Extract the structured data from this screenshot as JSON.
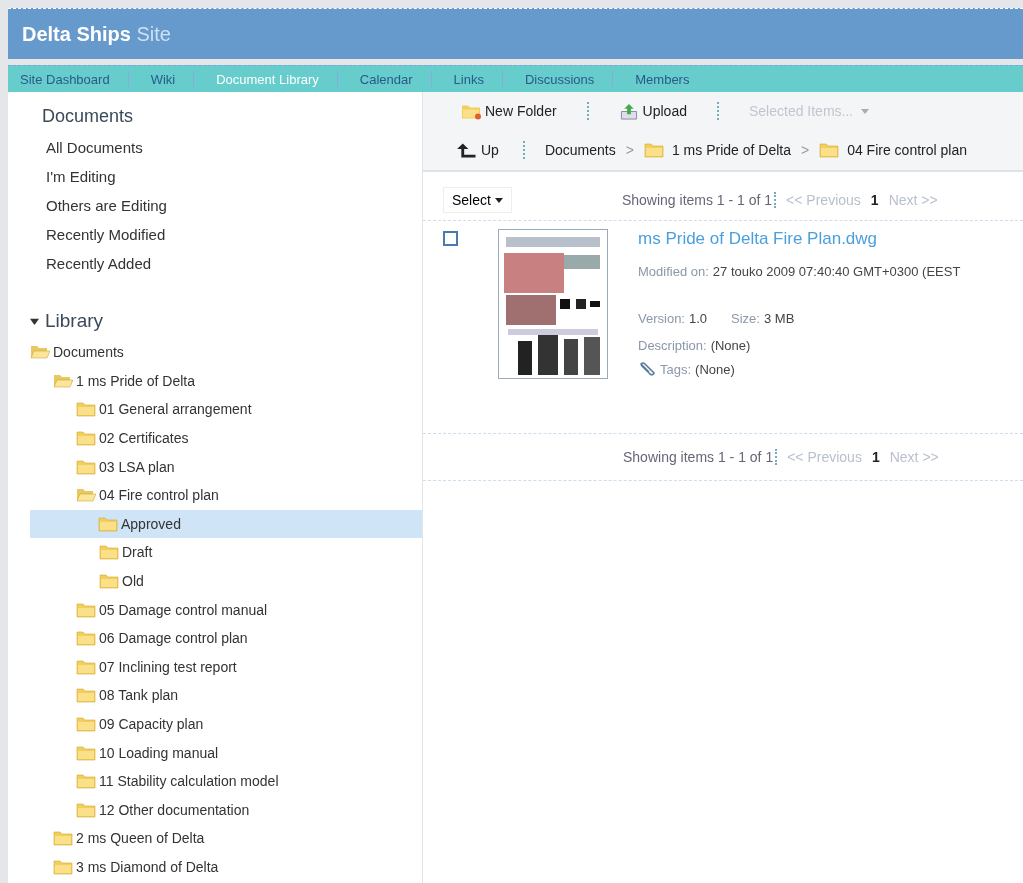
{
  "header": {
    "title": "Delta Ships",
    "subtitle": "Site"
  },
  "nav": [
    {
      "label": "Site Dashboard",
      "selected": false
    },
    {
      "label": "Wiki",
      "selected": false
    },
    {
      "label": "Document Library",
      "selected": true
    },
    {
      "label": "Calendar",
      "selected": false
    },
    {
      "label": "Links",
      "selected": false
    },
    {
      "label": "Discussions",
      "selected": false
    },
    {
      "label": "Members",
      "selected": false
    }
  ],
  "sidebar": {
    "filters_title": "Documents",
    "filters": [
      "All Documents",
      "I'm Editing",
      "Others are Editing",
      "Recently Modified",
      "Recently Added"
    ],
    "library": {
      "title": "Library",
      "expanded": true,
      "tree": [
        {
          "label": "Documents",
          "expanded": true,
          "selected": false,
          "children": [
            {
              "label": "1 ms Pride of Delta",
              "expanded": true,
              "selected": false,
              "children": [
                {
                  "label": "01 General arrangement",
                  "expanded": false,
                  "selected": false
                },
                {
                  "label": "02 Certificates",
                  "expanded": false,
                  "selected": false
                },
                {
                  "label": "03 LSA plan",
                  "expanded": false,
                  "selected": false
                },
                {
                  "label": "04 Fire control plan",
                  "expanded": true,
                  "selected": false,
                  "children": [
                    {
                      "label": "Approved",
                      "expanded": false,
                      "selected": true
                    },
                    {
                      "label": "Draft",
                      "expanded": false,
                      "selected": false
                    },
                    {
                      "label": "Old",
                      "expanded": false,
                      "selected": false
                    }
                  ]
                },
                {
                  "label": "05 Damage control manual",
                  "expanded": false,
                  "selected": false
                },
                {
                  "label": "06 Damage control plan",
                  "expanded": false,
                  "selected": false
                },
                {
                  "label": "07 Inclining test report",
                  "expanded": false,
                  "selected": false
                },
                {
                  "label": "08 Tank plan",
                  "expanded": false,
                  "selected": false
                },
                {
                  "label": "09 Capacity plan",
                  "expanded": false,
                  "selected": false
                },
                {
                  "label": "10 Loading manual",
                  "expanded": false,
                  "selected": false
                },
                {
                  "label": "11 Stability calculation model",
                  "expanded": false,
                  "selected": false
                },
                {
                  "label": "12 Other documentation",
                  "expanded": false,
                  "selected": false
                }
              ]
            },
            {
              "label": "2 ms Queen of Delta",
              "expanded": false,
              "selected": false
            },
            {
              "label": "3 ms Diamond of Delta",
              "expanded": false,
              "selected": false
            }
          ]
        }
      ]
    }
  },
  "toolbar": [
    {
      "kind": "new-folder",
      "label": "New Folder",
      "disabled": false
    },
    {
      "kind": "upload",
      "label": "Upload",
      "disabled": false
    },
    {
      "kind": "menu",
      "label": "Selected Items...",
      "disabled": true
    }
  ],
  "navigation": {
    "up": "Up",
    "breadcrumb": [
      {
        "label": "Documents",
        "folder": false
      },
      {
        "separator": ">",
        "label": "1 ms Pride of Delta",
        "folder": true
      },
      {
        "separator": ">",
        "label": "04 Fire control plan",
        "folder": true
      }
    ]
  },
  "select_button": "Select",
  "pagination_top": {
    "showing": "Showing items 1 - 1 of 1",
    "previous": "<< Previous",
    "page": "1",
    "next": "Next >>"
  },
  "documents": [
    {
      "name": "ms Pride of Delta Fire Plan.dwg",
      "checked": false,
      "modified_label": "Modified on:",
      "modified": "27 touko 2009 07:40:40 GMT+0300 (EEST",
      "version_label": "Version:",
      "version": "1.0",
      "size_label": "Size:",
      "size": "3 MB",
      "description_label": "Description:",
      "description": "(None)",
      "tags_label": "Tags:",
      "tags": "(None)"
    }
  ],
  "pagination_bottom": {
    "showing": "Showing items 1 - 1 of 1",
    "previous": "<< Previous",
    "page": "1",
    "next": "Next >>"
  }
}
